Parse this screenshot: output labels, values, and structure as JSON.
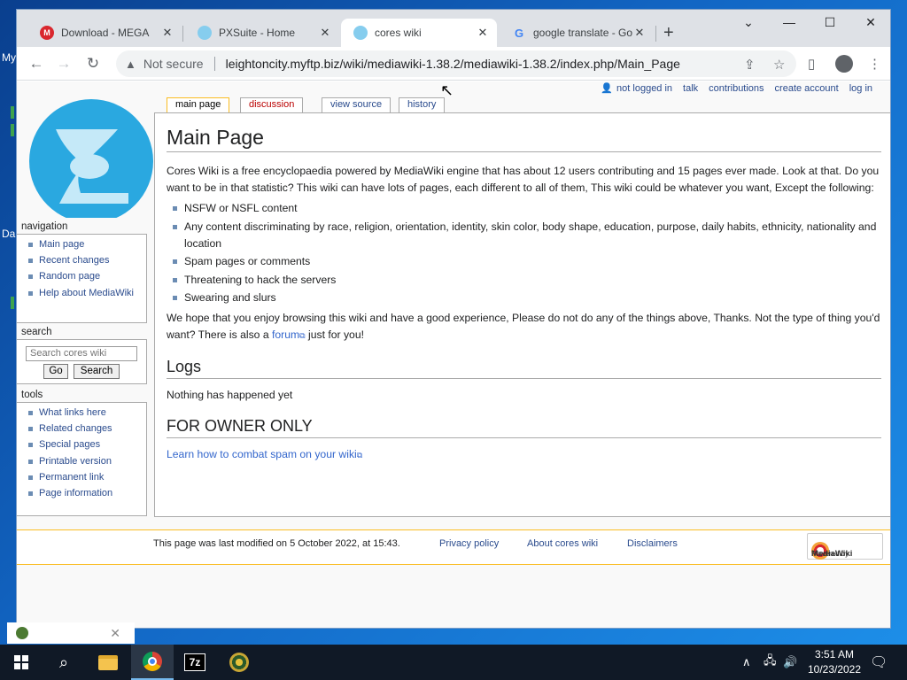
{
  "desktop": {
    "icon_labels": [
      "My",
      "Da"
    ]
  },
  "browser": {
    "tabs": [
      {
        "label": "Download - MEGA",
        "icon": "mega-icon",
        "active": false
      },
      {
        "label": "PXSuite - Home",
        "icon": "wiki-favicon",
        "active": false
      },
      {
        "label": "cores wiki",
        "icon": "wiki-favicon",
        "active": true
      },
      {
        "label": "google translate - Go",
        "icon": "google-icon",
        "active": false
      }
    ],
    "new_tab_symbol": "+",
    "security_label": "Not secure",
    "url": "leightoncity.myftp.biz/wiki/mediawiki-1.38.2/mediawiki-1.38.2/index.php/Main_Page"
  },
  "wiki": {
    "personal": [
      "not logged in",
      "talk",
      "contributions",
      "create account",
      "log in"
    ],
    "tabs": [
      "main page",
      "discussion",
      "view source",
      "history"
    ],
    "title": "Main Page",
    "intro": "Cores Wiki is a free encyclopaedia powered by MediaWiki engine that has about 12 users contributing and 15 pages ever made. Look at that. Do you want to be in that statistic? This wiki can have lots of pages, each different to all of them, This wiki could be whatever you want, Except the following:",
    "rules": [
      "NSFW or NSFL content",
      "Any content discriminating by race, religion, orientation, identity, skin color, body shape, education, purpose, daily habits, ethnicity, nationality and location",
      "Spam pages or comments",
      "Threatening to hack the servers",
      "Swearing and slurs"
    ],
    "outro_before": "We hope that you enjoy browsing this wiki and have a good experience, Please do not do any of the things above, Thanks. Not the type of thing you'd want? There is also a ",
    "outro_link": "forum",
    "outro_after": " just for you!",
    "logs_heading": "Logs",
    "logs_text": "Nothing has happened yet",
    "owner_heading": "FOR OWNER ONLY",
    "owner_link": "Learn how to combat spam on your wiki",
    "sidebar": {
      "navigation_title": "navigation",
      "navigation": [
        "Main page",
        "Recent changes",
        "Random page",
        "Help about MediaWiki"
      ],
      "search_title": "search",
      "search_placeholder": "Search cores wiki",
      "go_label": "Go",
      "search_label": "Search",
      "tools_title": "tools",
      "tools": [
        "What links here",
        "Related changes",
        "Special pages",
        "Printable version",
        "Permanent link",
        "Page information"
      ]
    },
    "footer": {
      "last_modified": "This page was last modified on 5 October 2022, at 15:43.",
      "privacy": "Privacy policy",
      "about": "About cores wiki",
      "disclaimers": "Disclaimers",
      "powered_by": "Powered by",
      "powered_name": "MediaWiki"
    }
  },
  "taskbar": {
    "time": "3:51 AM",
    "date": "10/23/2022"
  },
  "colors": {
    "link": "#3366cc",
    "tab_selected_border": "#fabd23",
    "taskbar": "#101926"
  }
}
